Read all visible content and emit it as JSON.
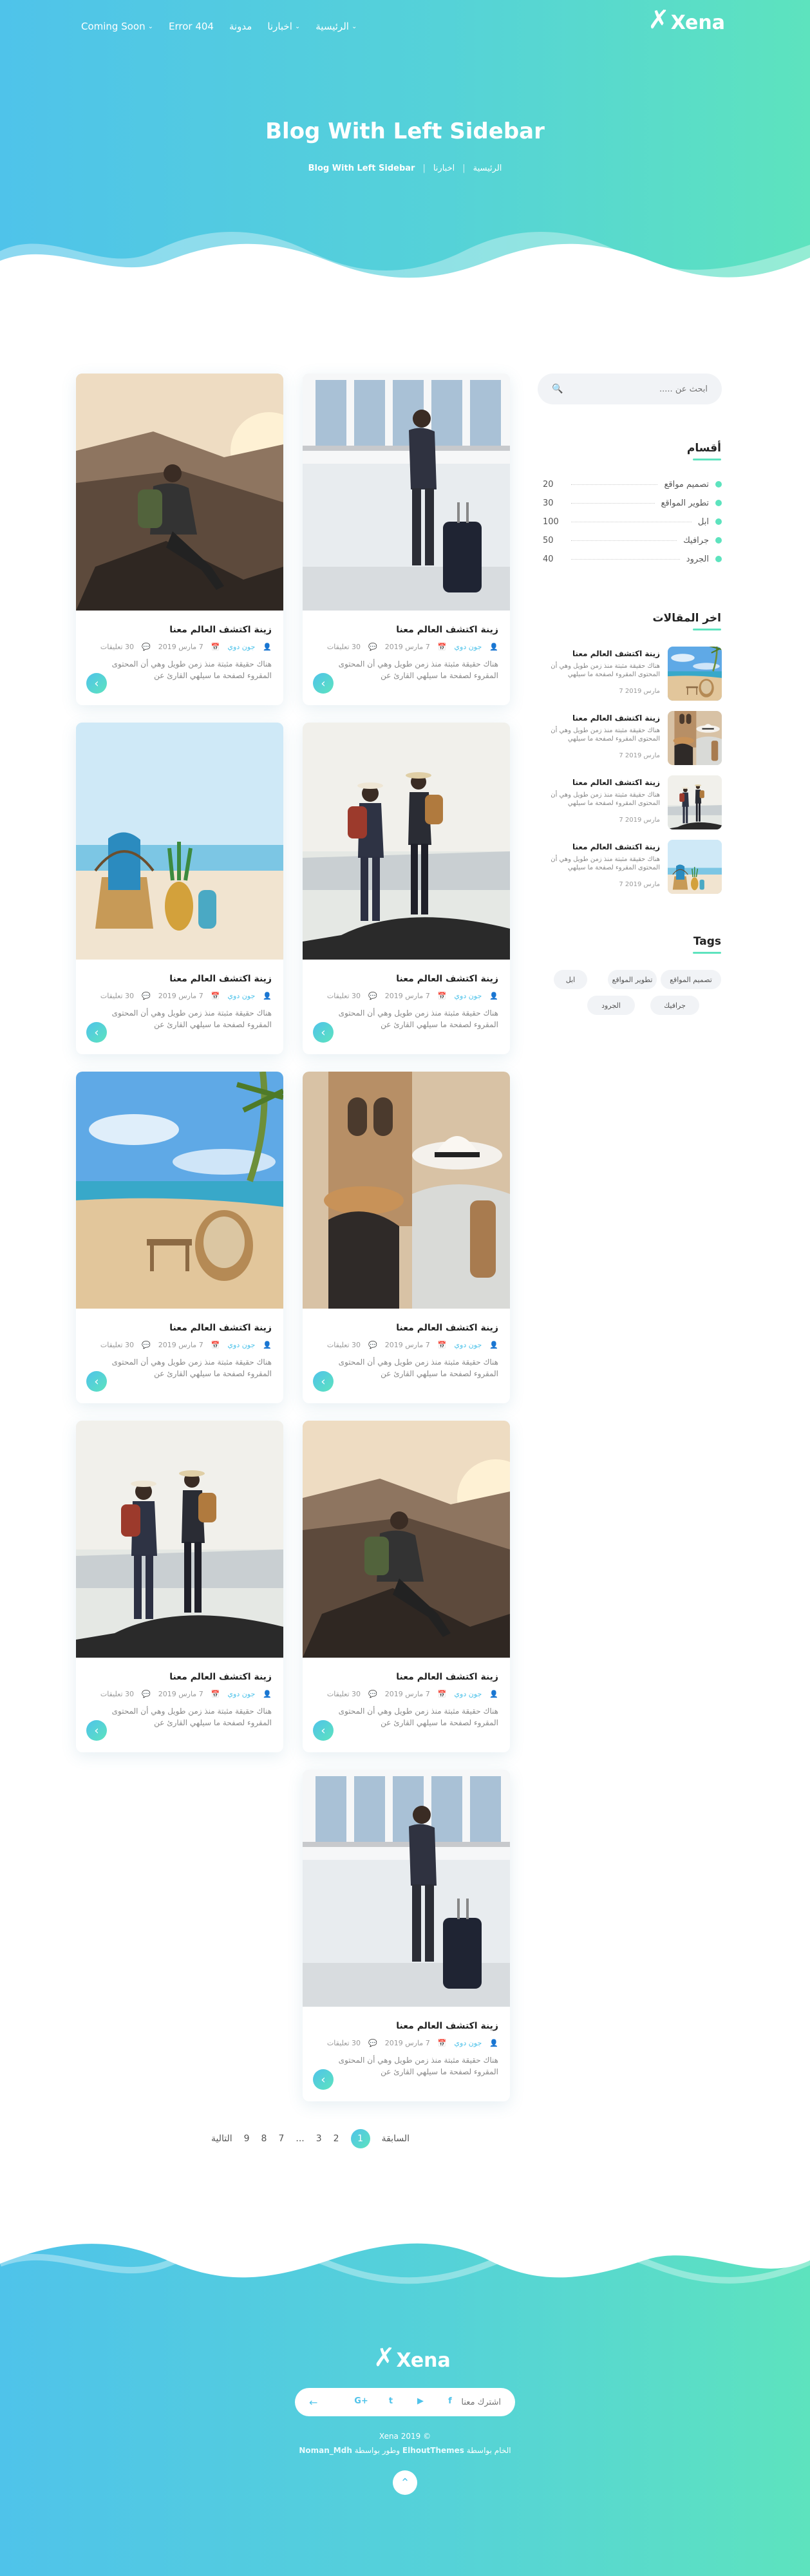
{
  "header": {
    "logo_text": "Xena",
    "nav": [
      {
        "label": "Coming Soon",
        "has_caret": true
      },
      {
        "label": "Error 404",
        "has_caret": false
      },
      {
        "label": "مدونة",
        "has_caret": false
      },
      {
        "label": "اخبارنا",
        "has_caret": true
      },
      {
        "label": "الرئيسية",
        "has_caret": true
      }
    ],
    "title": "Blog With Left Sidebar",
    "breadcrumb": [
      "الرئيسية",
      "اخبارنا",
      "Blog With Left Sidebar"
    ]
  },
  "posts": [
    {
      "title": "زينة اكتشف العالم معنا",
      "author": "جون دوي",
      "date": "7 مارس 2019",
      "comments": "30 تعليقات",
      "excerpt": "هناك حقيقة مثبتة منذ زمن طويل وهي أن المحتوى المقروء لصفحة ما سيلهي القارئ عن",
      "image": "traveler-suitcase"
    },
    {
      "title": "زينة اكتشف العالم معنا",
      "author": "جون دوي",
      "date": "7 مارس 2019",
      "comments": "30 تعليقات",
      "excerpt": "هناك حقيقة مثبتة منذ زمن طويل وهي أن المحتوى المقروء لصفحة ما سيلهي القارئ عن",
      "image": "hiker-sunset"
    },
    {
      "title": "زينة اكتشف العالم معنا",
      "author": "جون دوي",
      "date": "7 مارس 2019",
      "comments": "30 تعليقات",
      "excerpt": "هناك حقيقة مثبتة منذ زمن طويل وهي أن المحتوى المقروء لصفحة ما سيلهي القارئ عن",
      "image": "couple-rock"
    },
    {
      "title": "زينة اكتشف العالم معنا",
      "author": "جون دوي",
      "date": "7 مارس 2019",
      "comments": "30 تعليقات",
      "excerpt": "هناك حقيقة مثبتة منذ زمن طويل وهي أن المحتوى المقروء لصفحة ما سيلهي القارئ عن",
      "image": "beach-bags"
    },
    {
      "title": "زينة اكتشف العالم معنا",
      "author": "جون دوي",
      "date": "7 مارس 2019",
      "comments": "30 تعليقات",
      "excerpt": "هناك حقيقة مثبتة منذ زمن طويل وهي أن المحتوى المقروء لصفحة ما سيلهي القارئ عن",
      "image": "couple-hats"
    },
    {
      "title": "زينة اكتشف العالم معنا",
      "author": "جون دوي",
      "date": "7 مارس 2019",
      "comments": "30 تعليقات",
      "excerpt": "هناك حقيقة مثبتة منذ زمن طويل وهي أن المحتوى المقروء لصفحة ما سيلهي القارئ عن",
      "image": "beach-swing"
    },
    {
      "title": "زينة اكتشف العالم معنا",
      "author": "جون دوي",
      "date": "7 مارس 2019",
      "comments": "30 تعليقات",
      "excerpt": "هناك حقيقة مثبتة منذ زمن طويل وهي أن المحتوى المقروء لصفحة ما سيلهي القارئ عن",
      "image": "hiker-sunset"
    },
    {
      "title": "زينة اكتشف العالم معنا",
      "author": "جون دوي",
      "date": "7 مارس 2019",
      "comments": "30 تعليقات",
      "excerpt": "هناك حقيقة مثبتة منذ زمن طويل وهي أن المحتوى المقروء لصفحة ما سيلهي القارئ عن",
      "image": "couple-rock"
    },
    {
      "title": "زينة اكتشف العالم معنا",
      "author": "جون دوي",
      "date": "7 مارس 2019",
      "comments": "30 تعليقات",
      "excerpt": "هناك حقيقة مثبتة منذ زمن طويل وهي أن المحتوى المقروء لصفحة ما سيلهي القارئ عن",
      "image": "traveler-suitcase"
    }
  ],
  "pagination": {
    "prev": "السابقة",
    "pages": [
      "1",
      "2",
      "3",
      "...",
      "7",
      "8",
      "9"
    ],
    "current": "1",
    "next": "التالية"
  },
  "sidebar": {
    "search_placeholder": "ابحث عن .....",
    "categories_title": "أقسام",
    "categories": [
      {
        "name": "تصميم مواقع",
        "count": "20"
      },
      {
        "name": "تطوير المواقع",
        "count": "30"
      },
      {
        "name": "ابل",
        "count": "100"
      },
      {
        "name": "جرافيك",
        "count": "50"
      },
      {
        "name": "الجرود",
        "count": "40"
      }
    ],
    "recent_title": "اخر المقالات",
    "recent": [
      {
        "title": "زينة اكتشف العالم معنا",
        "text": "هناك حقيقة مثبتة منذ زمن طويل وهي أن المحتوى المقروء لصفحة ما سيلهي",
        "date": "7 مارس 2019",
        "image": "beach-swing"
      },
      {
        "title": "زينة اكتشف العالم معنا",
        "text": "هناك حقيقة مثبتة منذ زمن طويل وهي أن المحتوى المقروء لصفحة ما سيلهي",
        "date": "7 مارس 2019",
        "image": "couple-hats"
      },
      {
        "title": "زينة اكتشف العالم معنا",
        "text": "هناك حقيقة مثبتة منذ زمن طويل وهي أن المحتوى المقروء لصفحة ما سيلهي",
        "date": "7 مارس 2019",
        "image": "couple-rock"
      },
      {
        "title": "زينة اكتشف العالم معنا",
        "text": "هناك حقيقة مثبتة منذ زمن طويل وهي أن المحتوى المقروء لصفحة ما سيلهي",
        "date": "7 مارس 2019",
        "image": "beach-bags"
      }
    ],
    "tags_title": "Tags",
    "tags": [
      "تصميم المواقع",
      "تطوير المواقع",
      "ابل",
      "جرافيك",
      "الجرود"
    ]
  },
  "footer": {
    "logo_text": "Xena",
    "subscribe_placeholder": "اشترك معنا",
    "socials": [
      {
        "icon": "google-plus-icon",
        "glyph": "G+"
      },
      {
        "icon": "twitter-icon",
        "glyph": "t"
      },
      {
        "icon": "youtube-icon",
        "glyph": "▶"
      },
      {
        "icon": "facebook-icon",
        "glyph": "f"
      }
    ],
    "copyright": "Xena 2019 ©",
    "credits_prefix": "الخام بواسطة",
    "credits_brand": "ElhoutThemes",
    "credits_mid": "وطور بواسطة",
    "credits_dev": "Noman_Mdh"
  },
  "colors": {
    "accent_start": "#4fc3ea",
    "accent_end": "#5de3be"
  }
}
